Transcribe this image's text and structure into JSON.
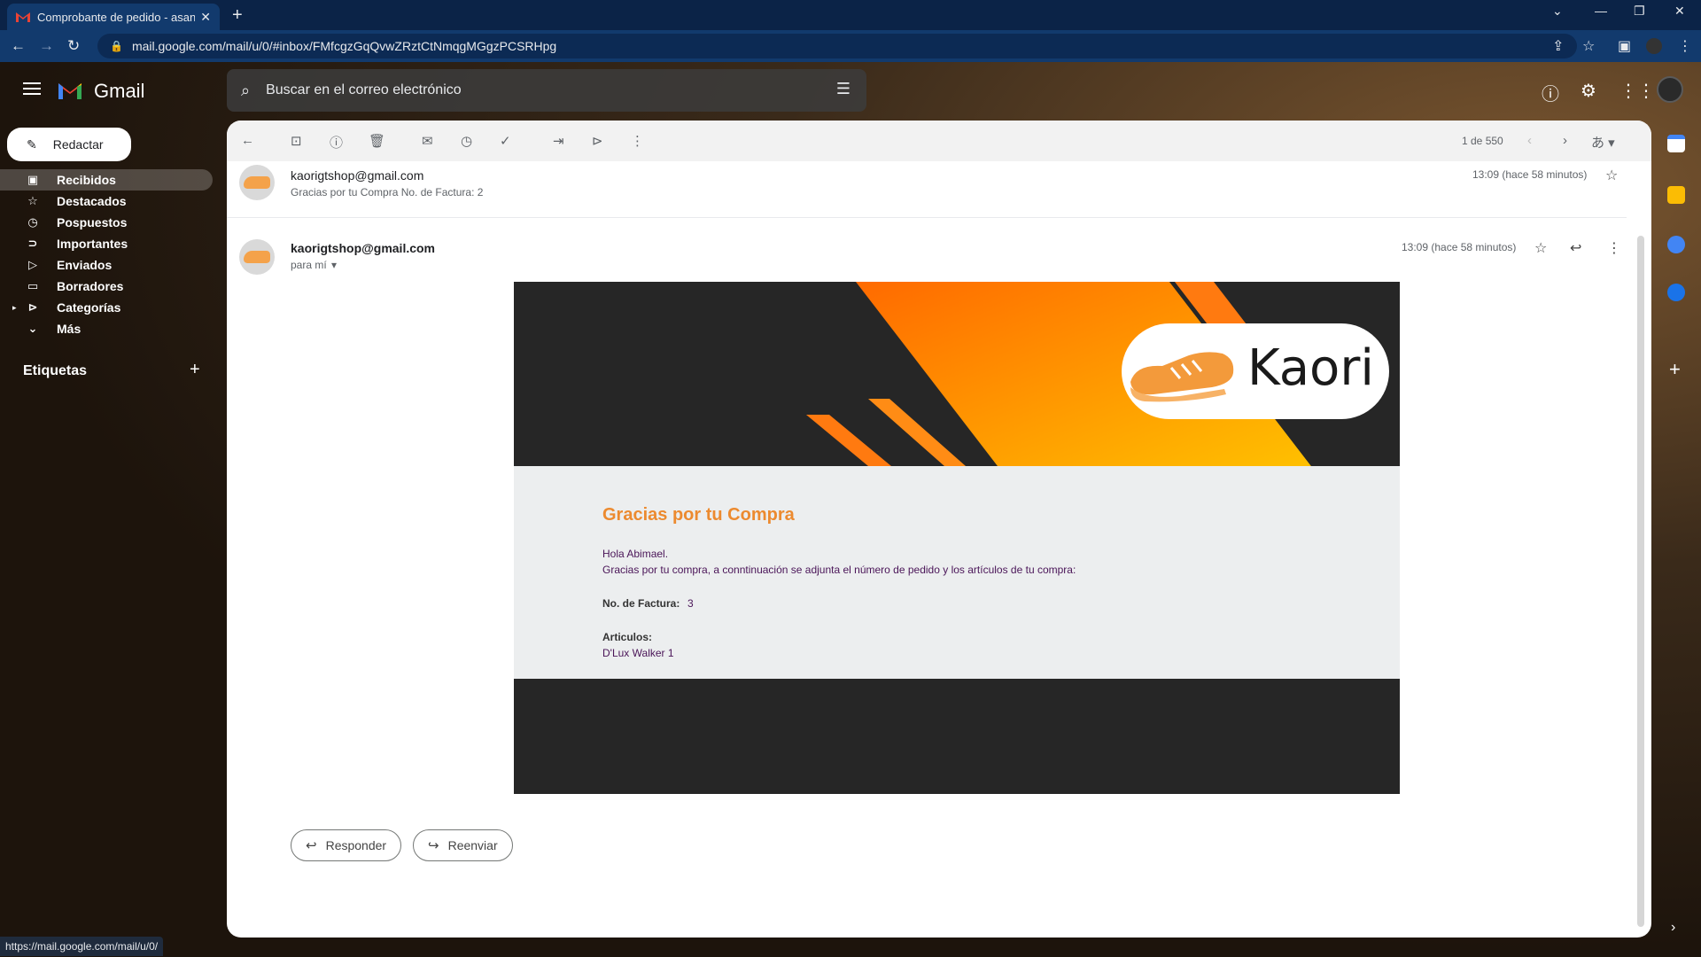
{
  "browser": {
    "tab_title": "Comprobante de pedido - asana",
    "url": "mail.google.com/mail/u/0/#inbox/FMfcgzGqQvwZRztCtNmqgMGgzPCSRHpg",
    "status_url": "https://mail.google.com/mail/u/0/"
  },
  "gmail": {
    "brand": "Gmail",
    "search_placeholder": "Buscar en el correo electrónico",
    "compose_label": "Redactar"
  },
  "sidebar": {
    "items": [
      {
        "label": "Recibidos",
        "icon": "inbox-icon",
        "active": true
      },
      {
        "label": "Destacados",
        "icon": "star-icon"
      },
      {
        "label": "Pospuestos",
        "icon": "clock-icon"
      },
      {
        "label": "Importantes",
        "icon": "important-icon"
      },
      {
        "label": "Enviados",
        "icon": "send-icon"
      },
      {
        "label": "Borradores",
        "icon": "draft-icon"
      },
      {
        "label": "Categorías",
        "icon": "label-icon"
      },
      {
        "label": "Más",
        "icon": "chevron-down-icon"
      }
    ],
    "labels_heading": "Etiquetas"
  },
  "toolbar": {
    "counter": "1 de 550"
  },
  "thread": {
    "collapsed": {
      "sender": "kaorigtshop@gmail.com",
      "snippet": "Gracias por tu Compra No. de Factura: 2",
      "time": "13:09 (hace 58 minutos)"
    },
    "open": {
      "sender": "kaorigtshop@gmail.com",
      "recipient": "para mí",
      "time": "13:09 (hace 58 minutos)"
    }
  },
  "email": {
    "brand_name": "Kaori",
    "title": "Gracias por tu Compra",
    "greeting": "Hola Abimael.",
    "intro": "Gracias por tu compra, a conntinuación se adjunta el número de pedido y los artículos de tu compra:",
    "invoice_label": "No. de Factura:",
    "invoice_number": "3",
    "items_label": "Articulos:",
    "item_line": "D'Lux Walker 1",
    "colors": {
      "accent": "#ec8a2f",
      "dark": "#262626",
      "text": "#4a1558"
    }
  },
  "actions": {
    "reply": "Responder",
    "forward": "Reenviar"
  }
}
